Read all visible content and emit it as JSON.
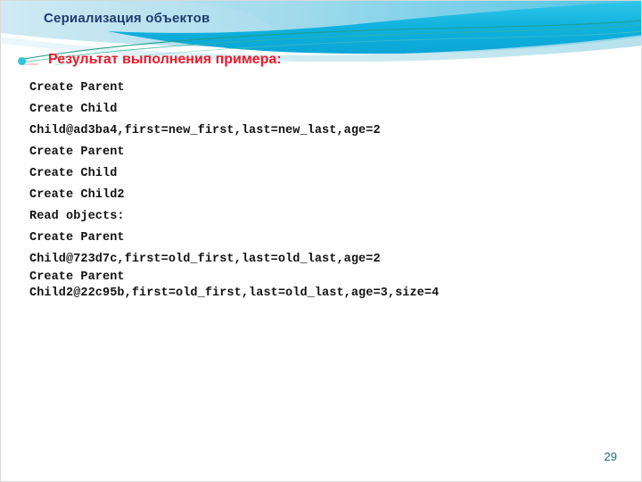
{
  "slide": {
    "title": "Сериализация объектов",
    "page_number": "29",
    "colors": {
      "title_text": "#1f3c6e",
      "heading_text": "#ea1c2d",
      "bullet_dot": "#2bc4d8",
      "banner_cyan": "#12b4dd",
      "banner_light": "#bfe6f0",
      "banner_teal_line": "#1f9e85",
      "code_text": "#121212",
      "page_number_text": "#1b6b6b"
    }
  },
  "content": {
    "heading": "Результат выполнения примера:",
    "code_lines": [
      {
        "text": "Create Parent",
        "tight": false
      },
      {
        "text": "Create Child",
        "tight": false
      },
      {
        "text": "Child@ad3ba4,first=new_first,last=new_last,age=2",
        "tight": false
      },
      {
        "text": "Create Parent",
        "tight": false
      },
      {
        "text": "Create Child",
        "tight": false
      },
      {
        "text": "Create Child2",
        "tight": false
      },
      {
        "text": "Read objects:",
        "tight": false
      },
      {
        "text": "Create Parent",
        "tight": false
      },
      {
        "text": "Child@723d7c,first=old_first,last=old_last,age=2",
        "tight": false
      },
      {
        "text": "Create Parent",
        "tight": true
      },
      {
        "text": "Child2@22c95b,first=old_first,last=old_last,age=3,size=4",
        "tight": true
      }
    ]
  }
}
